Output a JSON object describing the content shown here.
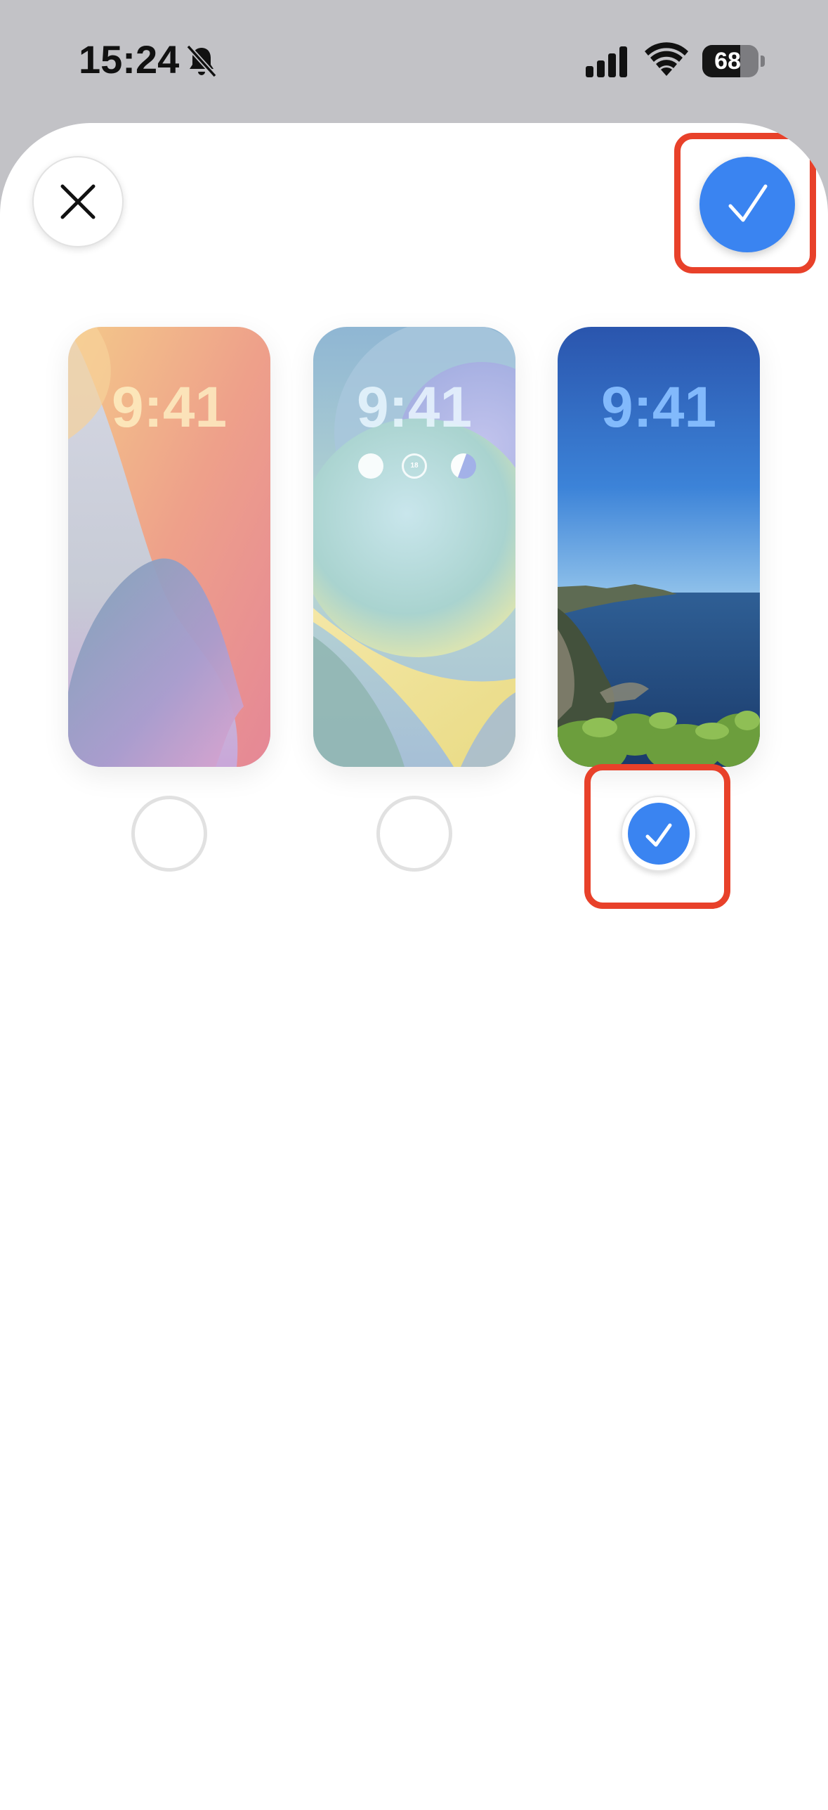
{
  "status_bar": {
    "time": "15:24",
    "battery_level": "68",
    "icons": [
      "bell-slash-icon",
      "cellular-signal-icon",
      "wifi-icon",
      "battery-icon"
    ]
  },
  "sheet": {
    "close_icon": "close-icon",
    "confirm_icon": "checkmark-icon",
    "accent_color": "#3a84f1",
    "highlight_color": "#e8412a"
  },
  "wallpapers": [
    {
      "time": "9:41",
      "style": "iOS gradient (orange / pink / purple)",
      "selected": false
    },
    {
      "time": "9:41",
      "style": "iOS gradient (teal / yellow)",
      "widgets": {
        "temperature": "18"
      },
      "selected": false
    },
    {
      "time": "9:41",
      "style": "Photo - coastline and blue sky",
      "selected": true
    }
  ]
}
